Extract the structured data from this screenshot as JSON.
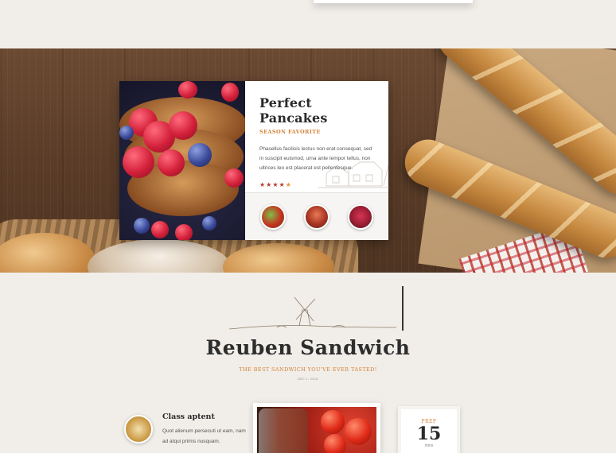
{
  "hero": {
    "card": {
      "title": "Perfect Pancakes",
      "subtitle": "SEASON FAVORITE",
      "description": "Phasellus facilisis lectus non erat consequat, sed in suscipit euismod, urna ante tempor tellus, non ultrices leo est placerat est pellentesque.",
      "rating": 4.5,
      "rating_stars": "★★★★",
      "rating_half": "★",
      "thumbnails": [
        "salad-thumbnail",
        "meat-thumbnail",
        "berries-thumbnail"
      ]
    }
  },
  "recipe": {
    "title": "Reuben Sandwich",
    "subtitle": "THE BEST SANDWICH YOU'VE EVER TASTED!",
    "meta": "DEC 1, 2016",
    "feature": {
      "title": "Class aptent",
      "text": "Quot alienum persecuti ut eam, nam ad atqui primis nusquam."
    },
    "prep": {
      "label": "PREP",
      "value": "15",
      "unit": "mins"
    }
  },
  "colors": {
    "accent": "#d4823a",
    "star": "#b33a2c",
    "background": "#f1eee9",
    "wood": "#5a3c28"
  }
}
